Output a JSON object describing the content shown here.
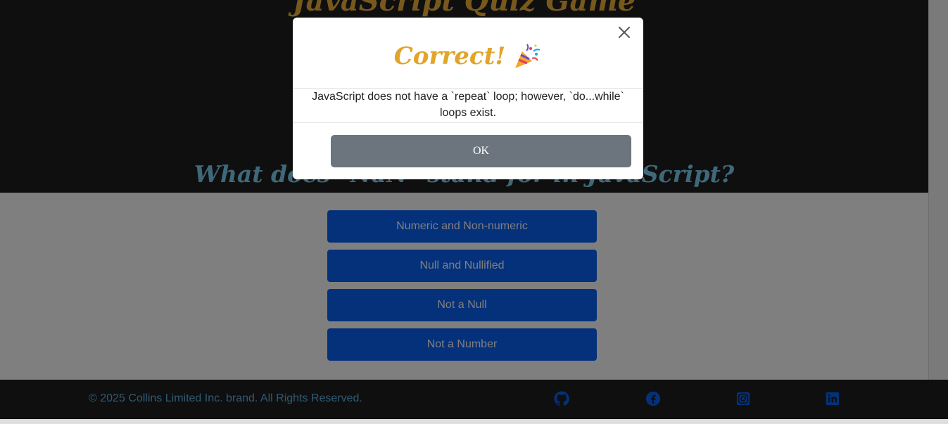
{
  "app": {
    "title": "JavaScript Quiz Game",
    "accent_color": "#f0b23b"
  },
  "quiz": {
    "question": "What does `NaN` stand for in JavaScript?",
    "answers": [
      {
        "label": "Numeric and Non-numeric"
      },
      {
        "label": "Null and Nullified"
      },
      {
        "label": "Not a Null"
      },
      {
        "label": "Not a Number"
      }
    ],
    "answer_color": "#0b63f6"
  },
  "modal": {
    "title": "Correct!",
    "title_icon": "party-popper-icon",
    "close_icon": "close-icon",
    "message": "JavaScript does not have a `repeat` loop; however, `do...while` loops exist.",
    "ok_label": "OK",
    "ok_color": "#6c757d"
  },
  "footer": {
    "copyright": "© 2025 Collins Limited Inc. brand. All Rights Reserved.",
    "social": [
      {
        "icon": "github-icon"
      },
      {
        "icon": "facebook-icon"
      },
      {
        "icon": "instagram-icon"
      },
      {
        "icon": "linkedin-icon"
      }
    ]
  }
}
